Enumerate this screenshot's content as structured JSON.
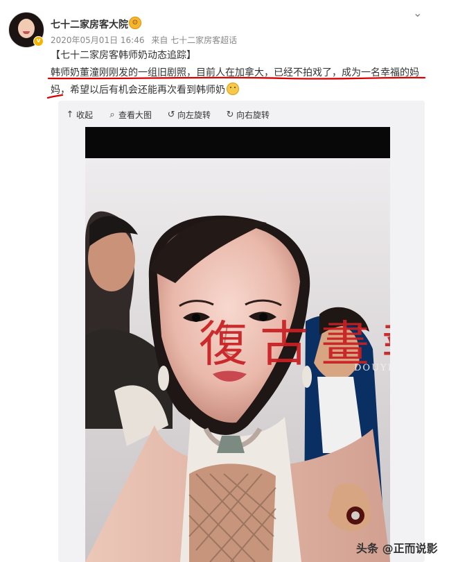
{
  "post": {
    "name": "七十二家房客大院",
    "date": "2020年05月01日 16:46",
    "source": "来自 七十二家房客超话",
    "title": "【七十二家房客韩师奶动态追踪】",
    "body_line_1": "韩师奶董潼刚刚发的一组旧剧照，目前人在加拿大，已经不拍戏了，成为一名幸福的妈",
    "body_line_2": "妈，希望以后有机会还能再次看到韩师奶"
  },
  "toolbar": {
    "collapse": "收起",
    "view_large": "查看大图",
    "rotate_left": "向左旋转",
    "rotate_right": "向右旋转"
  },
  "photo": {
    "title": "復古畫報",
    "subtitle": "DOUYIN VINTAGE"
  },
  "watermark": "头条 @正而说影",
  "colors": {
    "accent_red": "#c91f22",
    "underline_red": "#d90000",
    "verified_gold": "#f5b400"
  },
  "icons": {
    "collapse": "up-arrow-icon",
    "view_large": "search-icon",
    "rotate_left": "rotate-left-icon",
    "rotate_right": "rotate-right-icon",
    "more": "chevron-down-icon"
  }
}
